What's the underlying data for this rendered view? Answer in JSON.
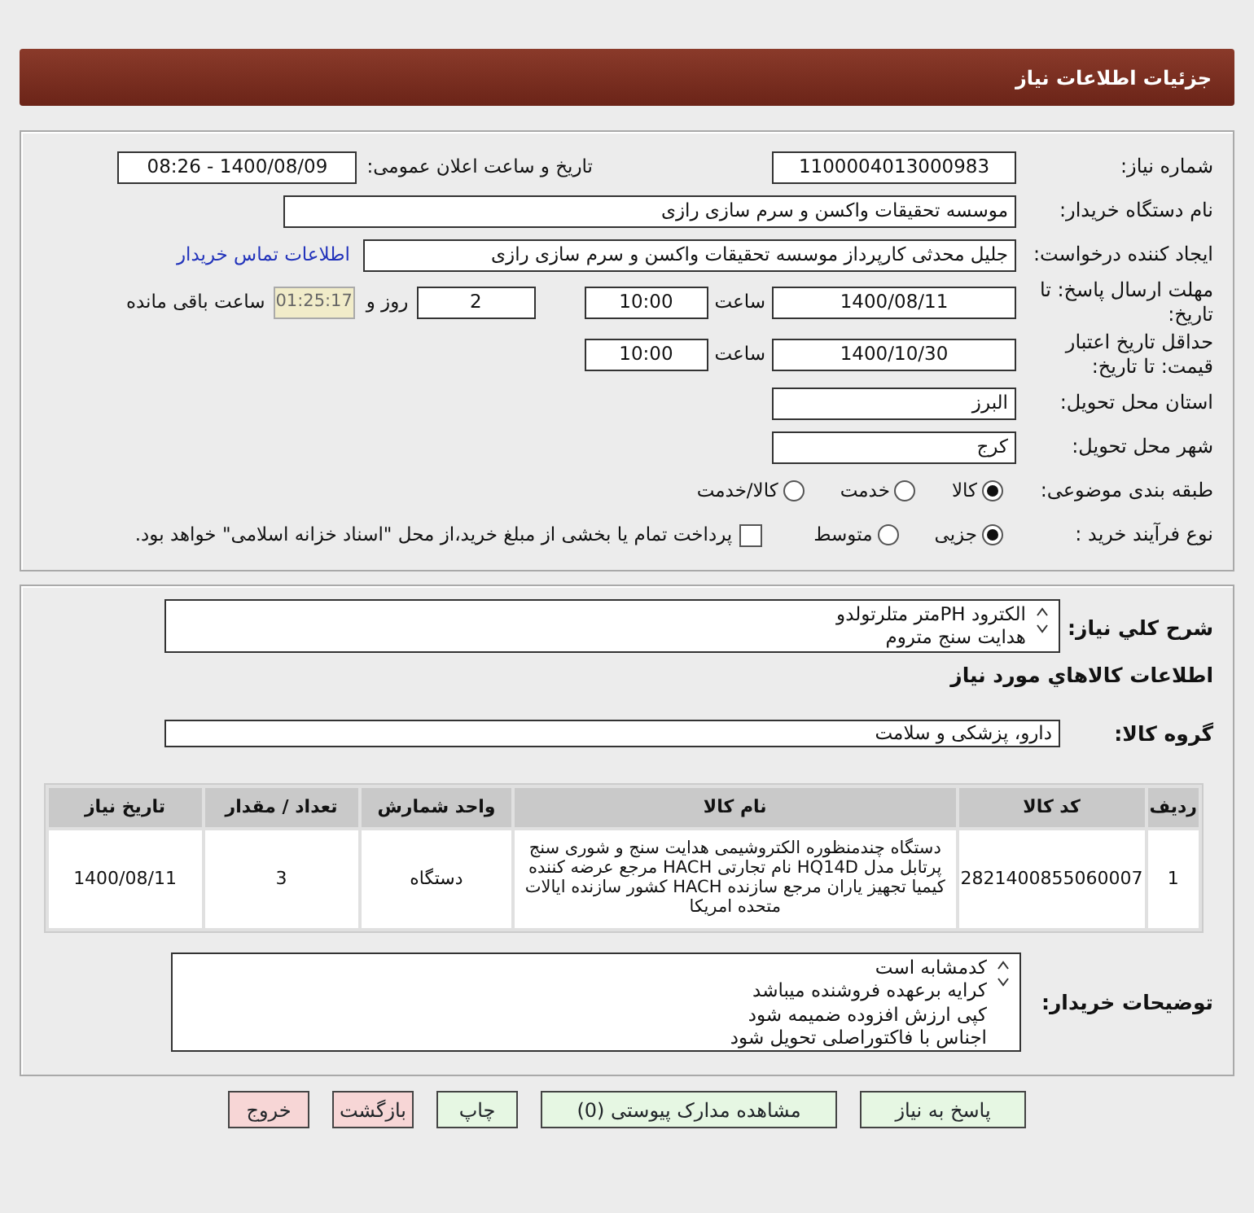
{
  "header": {
    "title": "جزئیات اطلاعات نیاز"
  },
  "need_number": {
    "label": "شماره نیاز:",
    "value": "1100004013000983"
  },
  "announce": {
    "label": "تاریخ و ساعت اعلان عمومی:",
    "value": "1400/08/09 - 08:26"
  },
  "buyer": {
    "label": "نام دستگاه خریدار:",
    "value": "موسسه تحقیقات واکسن و سرم سازی رازی"
  },
  "creator": {
    "label": "ایجاد کننده درخواست:",
    "value": "جلیل محدثی کارپرداز موسسه تحقیقات واکسن و سرم سازی رازی",
    "link": "اطلاعات تماس خریدار"
  },
  "deadline": {
    "label": "مهلت ارسال پاسخ: تا تاریخ:",
    "date": "1400/08/11",
    "time_label": "ساعت",
    "time": "10:00",
    "days": "2",
    "days_label": "روز و",
    "remaining": "01:25:17",
    "remaining_label": "ساعت باقی مانده"
  },
  "validity": {
    "label": "حداقل تاریخ اعتبار قیمت: تا تاریخ:",
    "date": "1400/10/30",
    "time_label": "ساعت",
    "time": "10:00"
  },
  "province": {
    "label": "استان محل تحویل:",
    "value": "البرز"
  },
  "city": {
    "label": "شهر محل تحویل:",
    "value": "کرج"
  },
  "category": {
    "label": "طبقه بندی موضوعی:",
    "options": [
      {
        "label": "کالا",
        "selected": true
      },
      {
        "label": "خدمت",
        "selected": false
      },
      {
        "label": "کالا/خدمت",
        "selected": false
      }
    ]
  },
  "process": {
    "label": "نوع فرآیند خرید :",
    "options": [
      {
        "label": "جزیی",
        "selected": true
      },
      {
        "label": "متوسط",
        "selected": false
      }
    ],
    "payment": {
      "checked": false,
      "label": "پرداخت تمام یا بخشی از مبلغ خرید،از محل \"اسناد خزانه اسلامی\" خواهد بود."
    }
  },
  "description": {
    "label": "شرح کلي نياز:",
    "lines": [
      "الکترود PHمتر متلرتولدو",
      "هدایت سنج متروم"
    ]
  },
  "goods_title": "اطلاعات کالاهاي مورد نياز",
  "goods_group": {
    "label": "گروه کالا:",
    "value": "دارو، پزشکی و سلامت"
  },
  "table": {
    "columns": [
      "ردیف",
      "کد کالا",
      "نام کالا",
      "واحد شمارش",
      "تعداد / مقدار",
      "تاریخ نیاز"
    ],
    "rows": [
      [
        "1",
        "2821400855060007",
        "دستگاه چندمنظوره الکتروشیمی هدایت سنج و شوری سنج پرتابل مدل HQ14D نام تجارتی HACH مرجع عرضه کننده کیمیا تجهیز یاران مرجع سازنده HACH کشور سازنده ایالات متحده امریکا",
        "دستگاه",
        "3",
        "1400/08/11"
      ]
    ]
  },
  "notes": {
    "label": "توضیحات خریدار:",
    "lines": [
      "کدمشابه است",
      "کرایه برعهده فروشنده میباشد",
      "کپی ارزش افزوده ضمیمه شود",
      "اجناس با فاکتوراصلی تحویل شود"
    ]
  },
  "buttons": [
    {
      "label": "پاسخ به نیاز",
      "kind": "green"
    },
    {
      "label": "مشاهده مدارک پیوستی (0)",
      "kind": "green"
    },
    {
      "label": "چاپ",
      "kind": "green"
    },
    {
      "label": "بازگشت",
      "kind": "red"
    },
    {
      "label": "خروج",
      "kind": "red"
    }
  ]
}
